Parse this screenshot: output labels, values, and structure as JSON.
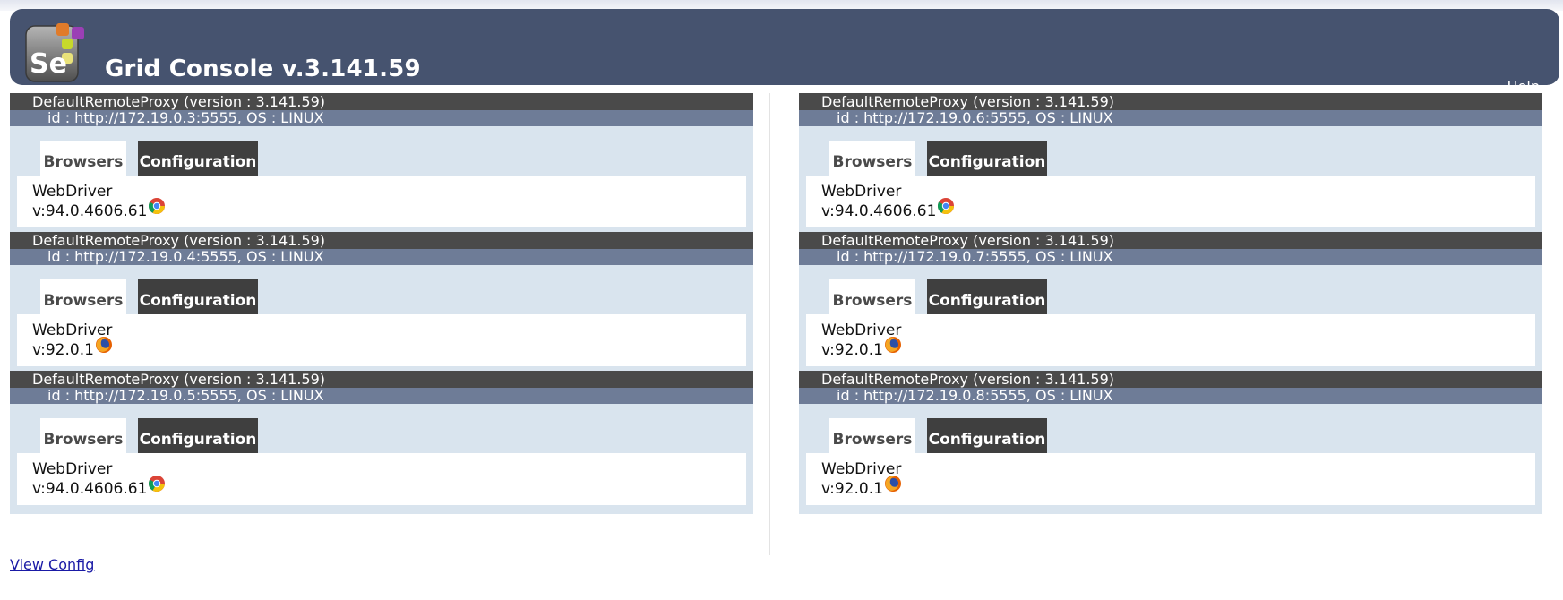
{
  "header": {
    "title": "Grid Console v.3.141.59",
    "help_label": "Help",
    "logo_text": "Se"
  },
  "colors": {
    "header_bg": "#46536f",
    "proxy_title_bg": "#4a4a4a",
    "proxy_id_bg": "#6e7c97",
    "proxy_body_bg": "#d9e4ee",
    "link": "#1a1aa6"
  },
  "tabs": {
    "browsers_label": "Browsers",
    "configuration_label": "Configuration"
  },
  "proxies": [
    {
      "title": "DefaultRemoteProxy (version : 3.141.59)",
      "id": "id : http://172.19.0.3:5555, OS : LINUX",
      "driver": "WebDriver",
      "version": "v:94.0.4606.61",
      "browser_icon": "chrome-icon"
    },
    {
      "title": "DefaultRemoteProxy (version : 3.141.59)",
      "id": "id : http://172.19.0.4:5555, OS : LINUX",
      "driver": "WebDriver",
      "version": "v:92.0.1",
      "browser_icon": "firefox-icon"
    },
    {
      "title": "DefaultRemoteProxy (version : 3.141.59)",
      "id": "id : http://172.19.0.5:5555, OS : LINUX",
      "driver": "WebDriver",
      "version": "v:94.0.4606.61",
      "browser_icon": "chrome-icon"
    },
    {
      "title": "DefaultRemoteProxy (version : 3.141.59)",
      "id": "id : http://172.19.0.6:5555, OS : LINUX",
      "driver": "WebDriver",
      "version": "v:94.0.4606.61",
      "browser_icon": "chrome-icon"
    },
    {
      "title": "DefaultRemoteProxy (version : 3.141.59)",
      "id": "id : http://172.19.0.7:5555, OS : LINUX",
      "driver": "WebDriver",
      "version": "v:92.0.1",
      "browser_icon": "firefox-icon"
    },
    {
      "title": "DefaultRemoteProxy (version : 3.141.59)",
      "id": "id : http://172.19.0.8:5555, OS : LINUX",
      "driver": "WebDriver",
      "version": "v:92.0.1",
      "browser_icon": "firefox-icon"
    }
  ],
  "footer": {
    "view_config_label": "View Config"
  }
}
